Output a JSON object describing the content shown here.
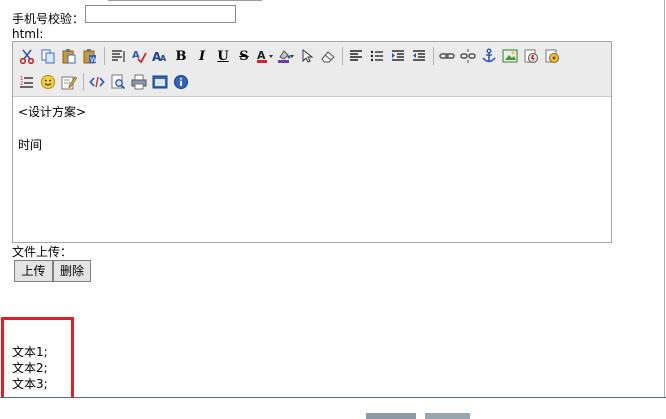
{
  "form": {
    "phone_label": "手机号校验：",
    "phone_value": "",
    "html_label": "html:"
  },
  "editor": {
    "toolbar_row1": [
      "cut-icon",
      "copy-icon",
      "paste-icon",
      "paste-word-icon",
      "|",
      "format-icon",
      "spellcheck-icon",
      "font-size-icon",
      "bold-icon",
      "italic-icon",
      "underline-icon",
      "strikethrough-icon",
      "font-color-icon",
      "highlight-icon",
      "select-icon",
      "eraser-icon",
      "|",
      "align-left-icon",
      "bulleted-list-icon",
      "indent-icon",
      "outdent-icon",
      "|",
      "link-icon",
      "unlink-icon",
      "anchor-icon",
      "image-icon",
      "flash-icon",
      "media-icon"
    ],
    "toolbar_row2": [
      "numbered-list-icon",
      "smiley-icon",
      "edit-icon",
      "|",
      "source-code-icon",
      "preview-icon",
      "print-icon",
      "fullscreen-icon",
      "about-icon"
    ],
    "toolbar_text": {
      "bold": "B",
      "italic": "I",
      "underline": "U",
      "strike": "S",
      "fontcolor": "A"
    },
    "content_line1": "<设计方案>",
    "content_line2": "时间"
  },
  "upload": {
    "label": "文件上传：",
    "upload_button": "上传",
    "delete_button": "删除"
  },
  "texts": [
    "文本1;",
    "文本2;",
    "文本3;"
  ],
  "colors": {
    "highlight_box": "#e01f26",
    "toolbar_bg": "#ebebeb",
    "bottom_line": "#4e6e7c"
  }
}
